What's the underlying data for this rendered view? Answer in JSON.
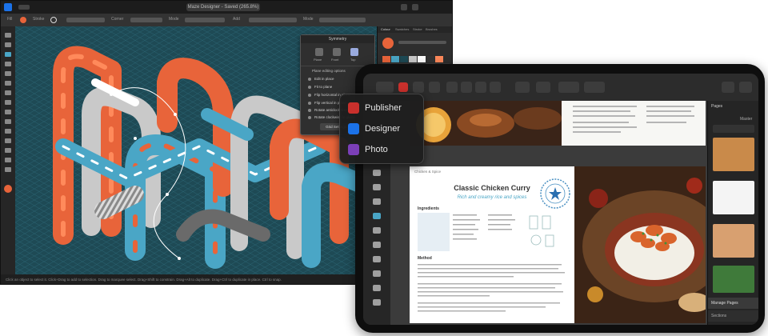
{
  "designer": {
    "app_icon": "affinity-designer-icon",
    "title": "Maze Designer - Saved (265.8%)",
    "toolbar": {
      "labels": [
        "Fill",
        "Stroke",
        "Corner",
        "Mode",
        "Add",
        "Mode"
      ]
    },
    "symmetry_panel": {
      "title": "Symmetry",
      "tabs": [
        "Plane",
        "Front",
        "Top"
      ],
      "options": [
        "Plane editing options",
        "Edit in place",
        "Fit to plane",
        "Flip horizontal in plane",
        "Flip vertical in plane",
        "Rotate anticlockwise",
        "Rotate clockwise in plane"
      ],
      "button": "Grid Settings..."
    },
    "status_text": "Click an object to select it. Click+Drag to add to selection. Drag to marquee select. Drag+Shift to constrain. Drag+Alt to duplicate. Drag+Ctrl to duplicate in place. Ctrl to snap.",
    "right_panel_tabs": [
      "Colour",
      "Swatches",
      "Stroke",
      "Brushes",
      "Appearance"
    ]
  },
  "switcher": {
    "items": [
      {
        "label": "Publisher",
        "icon": "publisher-icon",
        "color": "#c9302c"
      },
      {
        "label": "Designer",
        "icon": "designer-icon",
        "color": "#1b72e8"
      },
      {
        "label": "Photo",
        "icon": "photo-icon",
        "color": "#7b3fb8"
      }
    ]
  },
  "publisher": {
    "doc": {
      "breadcrumb": "Chicken & Spice",
      "title": "Classic Chicken Curry",
      "subtitle": "Rich and creamy rice and spices",
      "ingredients_heading": "Ingredients",
      "method_heading": "Method"
    },
    "pages_panel": {
      "title": "Pages",
      "master": "Master",
      "manage": "Manage Pages",
      "bottom": "Sections"
    }
  },
  "colors": {
    "teal": "#1e4a55",
    "orange": "#e8643a",
    "cyan": "#4aa6c6",
    "grey": "#c9c9c9"
  }
}
